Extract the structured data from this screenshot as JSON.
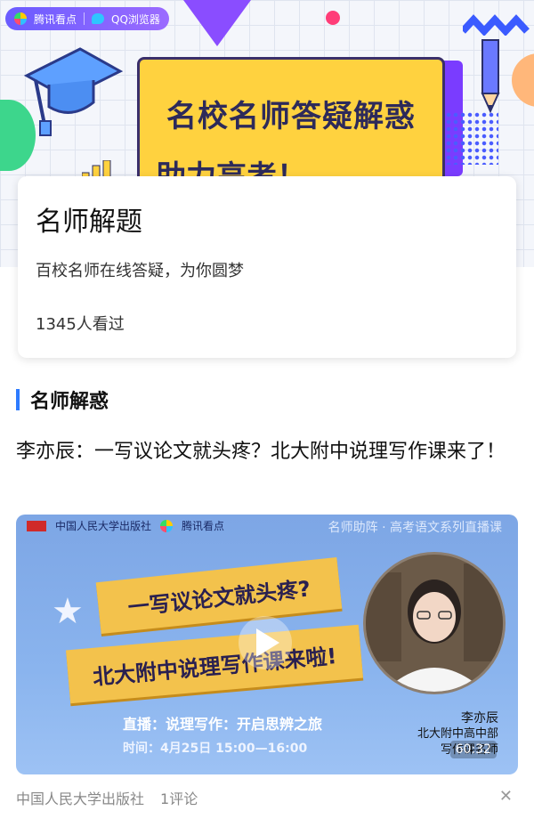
{
  "brand": {
    "left": "腾讯看点",
    "right": "QQ浏览器"
  },
  "hero": {
    "line1": "名校名师答疑解惑",
    "line2": "助力高考！"
  },
  "card": {
    "title": "名师解题",
    "subtitle": "百校名师在线答疑，为你圆梦",
    "views": "1345人看过"
  },
  "section": {
    "label": "名师解惑"
  },
  "article": {
    "headline": "李亦辰：一写议论文就头疼？北大附中说理写作课来了！",
    "video": {
      "publisher_logo": "中国人民大学出版社",
      "platform_logo": "腾讯看点",
      "series": "名师助阵 · 高考语文系列直播课",
      "banner1": "一写议论文就头疼?",
      "banner2": "北大附中说理写作课来啦!",
      "live_line": "直播：说理写作：开启思辨之旅",
      "time_line": "时间：4月25日 15:00—16:00",
      "teacher_name": "李亦辰",
      "teacher_title1": "北大附中高中部",
      "teacher_title2": "写作课名师",
      "duration": "60:32"
    },
    "source": "中国人民大学出版社",
    "comments": "1评论"
  },
  "icons": {
    "play": "play-icon",
    "close": "close-icon",
    "cap": "graduation-cap-icon",
    "pencil": "pencil-icon"
  },
  "colors": {
    "accent": "#2d7bff",
    "brand_purple": "#6a5cff",
    "yellow": "#ffd23f"
  }
}
